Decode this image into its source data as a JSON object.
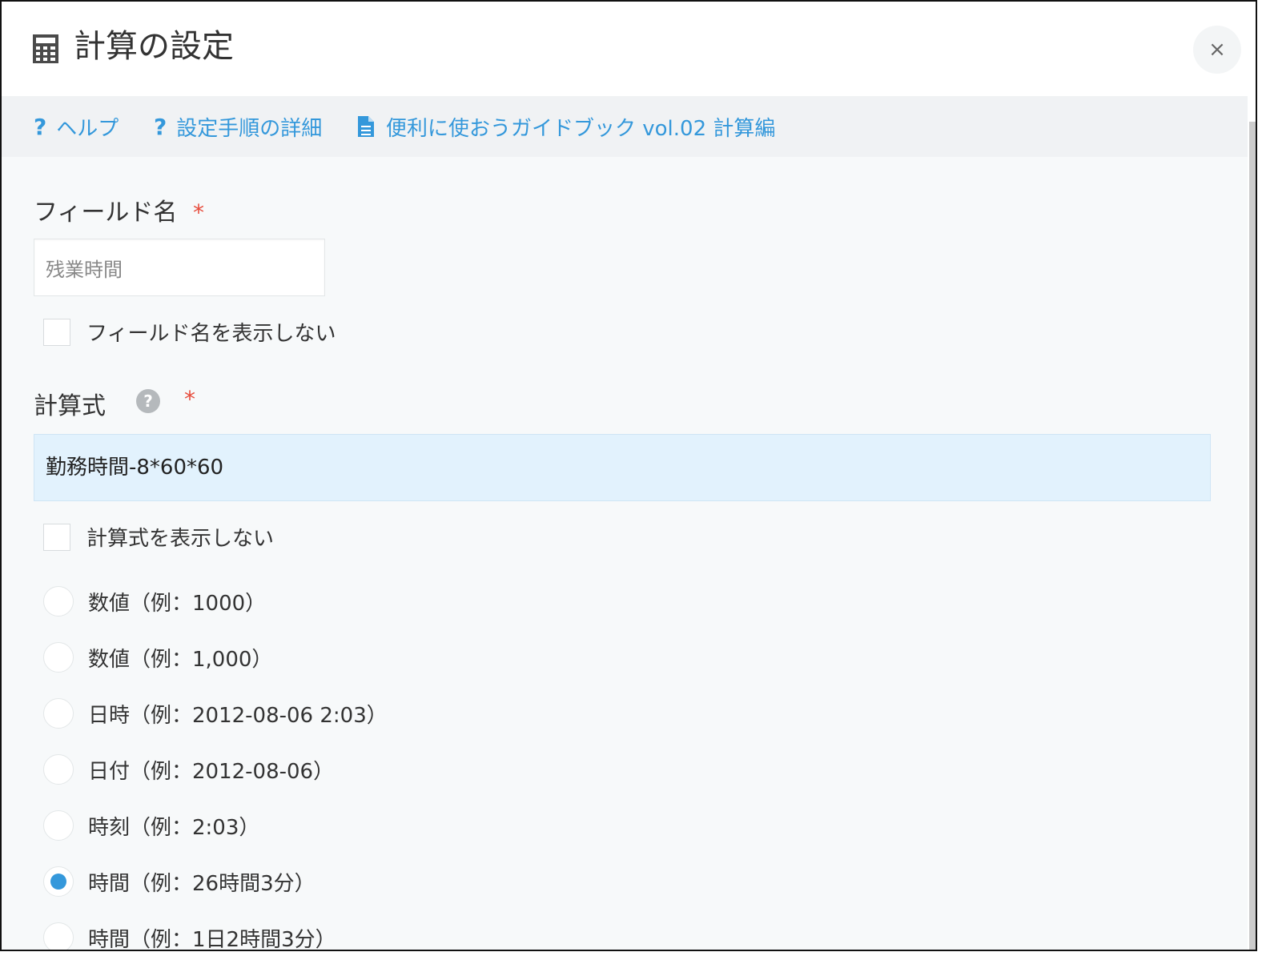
{
  "dialog": {
    "title": "計算の設定",
    "title_icon": "calculator-icon",
    "close_label": "×"
  },
  "help_links": [
    {
      "icon": "question-icon",
      "label": "ヘルプ"
    },
    {
      "icon": "question-icon",
      "label": "設定手順の詳細"
    },
    {
      "icon": "document-icon",
      "label": "便利に使おうガイドブック vol.02 計算編"
    }
  ],
  "field_name": {
    "label": "フィールド名",
    "required_mark": "*",
    "value": "残業時間",
    "hide_checkbox_label": "フィールド名を表示しない",
    "hide_checked": false
  },
  "formula": {
    "label": "計算式",
    "help_icon": "question-circle-icon",
    "required_mark": "*",
    "value": "勤務時間-8*60*60",
    "hide_checkbox_label": "計算式を表示しない",
    "hide_checked": false
  },
  "format_options": [
    {
      "label": "数値（例：1000）",
      "checked": false
    },
    {
      "label": "数値（例：1,000）",
      "checked": false
    },
    {
      "label": "日時（例：2012-08-06 2:03）",
      "checked": false
    },
    {
      "label": "日付（例：2012-08-06）",
      "checked": false
    },
    {
      "label": "時刻（例：2:03）",
      "checked": false
    },
    {
      "label": "時間（例：26時間3分）",
      "checked": true
    },
    {
      "label": "時間（例：1日2時間3分）",
      "checked": false
    }
  ],
  "colors": {
    "accent": "#3498db",
    "required": "#e74c3c",
    "formula_background": "#e2f2fd"
  }
}
